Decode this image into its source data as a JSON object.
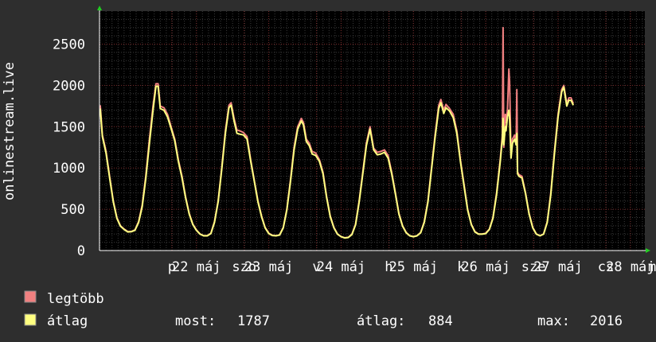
{
  "chart_data": {
    "type": "line",
    "ylabel": "onlinestream.live",
    "ylim": [
      0,
      2900
    ],
    "yticks": [
      0,
      500,
      1000,
      1500,
      2000,
      2500
    ],
    "grid": true,
    "x_tick_labels": [
      "p",
      "22 máj",
      "szo",
      "23 máj",
      "v",
      "24 máj",
      "h",
      "25 máj",
      "k",
      "26 máj",
      "sze",
      "27 máj",
      "cs",
      "28 máj"
    ],
    "x_tick_days": [
      1.66,
      2.0,
      2.66,
      3.0,
      3.66,
      4.0,
      4.66,
      5.0,
      5.66,
      6.0,
      6.66,
      7.0,
      7.66,
      8.0
    ],
    "x_truncated_label": "m",
    "x_range_days": [
      0.66,
      8.2
    ],
    "series": [
      {
        "name": "legtöbb",
        "color": "#f08080",
        "points": [
          [
            0.67,
            1760
          ],
          [
            0.7,
            1400
          ],
          [
            0.75,
            1200
          ],
          [
            0.8,
            900
          ],
          [
            0.85,
            600
          ],
          [
            0.9,
            400
          ],
          [
            0.95,
            300
          ],
          [
            1.0,
            260
          ],
          [
            1.05,
            230
          ],
          [
            1.1,
            230
          ],
          [
            1.15,
            250
          ],
          [
            1.2,
            350
          ],
          [
            1.25,
            550
          ],
          [
            1.3,
            900
          ],
          [
            1.35,
            1350
          ],
          [
            1.4,
            1750
          ],
          [
            1.44,
            2020
          ],
          [
            1.47,
            2020
          ],
          [
            1.5,
            1750
          ],
          [
            1.55,
            1730
          ],
          [
            1.6,
            1650
          ],
          [
            1.65,
            1500
          ],
          [
            1.7,
            1350
          ],
          [
            1.75,
            1100
          ],
          [
            1.8,
            900
          ],
          [
            1.85,
            650
          ],
          [
            1.9,
            450
          ],
          [
            1.95,
            320
          ],
          [
            2.0,
            250
          ],
          [
            2.05,
            200
          ],
          [
            2.1,
            180
          ],
          [
            2.15,
            180
          ],
          [
            2.2,
            210
          ],
          [
            2.25,
            350
          ],
          [
            2.3,
            600
          ],
          [
            2.35,
            1000
          ],
          [
            2.4,
            1450
          ],
          [
            2.45,
            1760
          ],
          [
            2.48,
            1790
          ],
          [
            2.52,
            1600
          ],
          [
            2.56,
            1460
          ],
          [
            2.6,
            1450
          ],
          [
            2.65,
            1430
          ],
          [
            2.7,
            1380
          ],
          [
            2.75,
            1100
          ],
          [
            2.8,
            850
          ],
          [
            2.85,
            600
          ],
          [
            2.9,
            420
          ],
          [
            2.95,
            280
          ],
          [
            3.0,
            210
          ],
          [
            3.05,
            185
          ],
          [
            3.1,
            180
          ],
          [
            3.15,
            190
          ],
          [
            3.2,
            280
          ],
          [
            3.25,
            500
          ],
          [
            3.3,
            850
          ],
          [
            3.35,
            1250
          ],
          [
            3.4,
            1500
          ],
          [
            3.45,
            1600
          ],
          [
            3.48,
            1550
          ],
          [
            3.52,
            1350
          ],
          [
            3.56,
            1300
          ],
          [
            3.6,
            1200
          ],
          [
            3.65,
            1180
          ],
          [
            3.7,
            1100
          ],
          [
            3.75,
            950
          ],
          [
            3.8,
            650
          ],
          [
            3.85,
            420
          ],
          [
            3.9,
            280
          ],
          [
            3.95,
            200
          ],
          [
            4.0,
            170
          ],
          [
            4.05,
            155
          ],
          [
            4.1,
            160
          ],
          [
            4.15,
            200
          ],
          [
            4.2,
            320
          ],
          [
            4.25,
            600
          ],
          [
            4.3,
            950
          ],
          [
            4.35,
            1300
          ],
          [
            4.4,
            1500
          ],
          [
            4.45,
            1240
          ],
          [
            4.5,
            1190
          ],
          [
            4.55,
            1200
          ],
          [
            4.6,
            1220
          ],
          [
            4.65,
            1150
          ],
          [
            4.7,
            950
          ],
          [
            4.75,
            700
          ],
          [
            4.8,
            450
          ],
          [
            4.85,
            300
          ],
          [
            4.9,
            220
          ],
          [
            4.95,
            180
          ],
          [
            5.0,
            170
          ],
          [
            5.05,
            180
          ],
          [
            5.1,
            220
          ],
          [
            5.15,
            350
          ],
          [
            5.2,
            600
          ],
          [
            5.25,
            1000
          ],
          [
            5.3,
            1400
          ],
          [
            5.35,
            1760
          ],
          [
            5.38,
            1830
          ],
          [
            5.42,
            1700
          ],
          [
            5.45,
            1770
          ],
          [
            5.5,
            1720
          ],
          [
            5.55,
            1650
          ],
          [
            5.6,
            1450
          ],
          [
            5.65,
            1100
          ],
          [
            5.7,
            800
          ],
          [
            5.75,
            500
          ],
          [
            5.8,
            320
          ],
          [
            5.85,
            230
          ],
          [
            5.9,
            200
          ],
          [
            5.95,
            200
          ],
          [
            6.0,
            210
          ],
          [
            6.05,
            260
          ],
          [
            6.1,
            400
          ],
          [
            6.15,
            700
          ],
          [
            6.2,
            1100
          ],
          [
            6.23,
            1400
          ],
          [
            6.24,
            2700
          ],
          [
            6.25,
            1250
          ],
          [
            6.27,
            1650
          ],
          [
            6.28,
            1550
          ],
          [
            6.3,
            1700
          ],
          [
            6.32,
            2200
          ],
          [
            6.33,
            2050
          ],
          [
            6.35,
            1150
          ],
          [
            6.37,
            1350
          ],
          [
            6.4,
            1400
          ],
          [
            6.42,
            1300
          ],
          [
            6.43,
            1950
          ],
          [
            6.44,
            950
          ],
          [
            6.46,
            920
          ],
          [
            6.5,
            900
          ],
          [
            6.55,
            700
          ],
          [
            6.6,
            450
          ],
          [
            6.65,
            280
          ],
          [
            6.7,
            200
          ],
          [
            6.75,
            180
          ],
          [
            6.8,
            200
          ],
          [
            6.85,
            350
          ],
          [
            6.9,
            700
          ],
          [
            6.95,
            1200
          ],
          [
            7.0,
            1650
          ],
          [
            7.05,
            1950
          ],
          [
            7.08,
            2000
          ],
          [
            7.12,
            1780
          ],
          [
            7.15,
            1850
          ],
          [
            7.18,
            1850
          ],
          [
            7.21,
            1780
          ]
        ]
      },
      {
        "name": "átlag",
        "color": "#ffff80",
        "points": [
          [
            0.67,
            1720
          ],
          [
            0.7,
            1380
          ],
          [
            0.75,
            1180
          ],
          [
            0.8,
            880
          ],
          [
            0.85,
            590
          ],
          [
            0.9,
            390
          ],
          [
            0.95,
            295
          ],
          [
            1.0,
            255
          ],
          [
            1.05,
            225
          ],
          [
            1.1,
            228
          ],
          [
            1.15,
            245
          ],
          [
            1.2,
            340
          ],
          [
            1.25,
            530
          ],
          [
            1.3,
            870
          ],
          [
            1.35,
            1300
          ],
          [
            1.4,
            1700
          ],
          [
            1.44,
            1990
          ],
          [
            1.47,
            1990
          ],
          [
            1.5,
            1720
          ],
          [
            1.55,
            1700
          ],
          [
            1.6,
            1620
          ],
          [
            1.65,
            1480
          ],
          [
            1.7,
            1330
          ],
          [
            1.75,
            1080
          ],
          [
            1.8,
            880
          ],
          [
            1.85,
            640
          ],
          [
            1.9,
            440
          ],
          [
            1.95,
            315
          ],
          [
            2.0,
            245
          ],
          [
            2.05,
            198
          ],
          [
            2.1,
            178
          ],
          [
            2.15,
            178
          ],
          [
            2.2,
            205
          ],
          [
            2.25,
            340
          ],
          [
            2.3,
            590
          ],
          [
            2.35,
            980
          ],
          [
            2.4,
            1420
          ],
          [
            2.45,
            1730
          ],
          [
            2.48,
            1760
          ],
          [
            2.52,
            1570
          ],
          [
            2.56,
            1420
          ],
          [
            2.6,
            1410
          ],
          [
            2.65,
            1400
          ],
          [
            2.7,
            1350
          ],
          [
            2.75,
            1080
          ],
          [
            2.8,
            840
          ],
          [
            2.85,
            590
          ],
          [
            2.9,
            410
          ],
          [
            2.95,
            275
          ],
          [
            3.0,
            205
          ],
          [
            3.05,
            182
          ],
          [
            3.1,
            178
          ],
          [
            3.15,
            188
          ],
          [
            3.2,
            275
          ],
          [
            3.25,
            490
          ],
          [
            3.3,
            830
          ],
          [
            3.35,
            1220
          ],
          [
            3.4,
            1470
          ],
          [
            3.45,
            1570
          ],
          [
            3.48,
            1520
          ],
          [
            3.52,
            1320
          ],
          [
            3.56,
            1270
          ],
          [
            3.6,
            1170
          ],
          [
            3.65,
            1150
          ],
          [
            3.7,
            1080
          ],
          [
            3.75,
            930
          ],
          [
            3.8,
            640
          ],
          [
            3.85,
            410
          ],
          [
            3.9,
            275
          ],
          [
            3.95,
            198
          ],
          [
            4.0,
            168
          ],
          [
            4.05,
            152
          ],
          [
            4.1,
            158
          ],
          [
            4.15,
            195
          ],
          [
            4.2,
            310
          ],
          [
            4.25,
            585
          ],
          [
            4.3,
            930
          ],
          [
            4.35,
            1270
          ],
          [
            4.4,
            1470
          ],
          [
            4.45,
            1220
          ],
          [
            4.5,
            1160
          ],
          [
            4.55,
            1170
          ],
          [
            4.6,
            1190
          ],
          [
            4.65,
            1120
          ],
          [
            4.7,
            930
          ],
          [
            4.75,
            690
          ],
          [
            4.8,
            440
          ],
          [
            4.85,
            295
          ],
          [
            4.9,
            215
          ],
          [
            4.95,
            178
          ],
          [
            5.0,
            168
          ],
          [
            5.05,
            178
          ],
          [
            5.1,
            215
          ],
          [
            5.15,
            340
          ],
          [
            5.2,
            585
          ],
          [
            5.25,
            980
          ],
          [
            5.3,
            1370
          ],
          [
            5.35,
            1720
          ],
          [
            5.38,
            1790
          ],
          [
            5.42,
            1660
          ],
          [
            5.45,
            1730
          ],
          [
            5.5,
            1690
          ],
          [
            5.55,
            1610
          ],
          [
            5.6,
            1420
          ],
          [
            5.65,
            1080
          ],
          [
            5.7,
            780
          ],
          [
            5.75,
            490
          ],
          [
            5.8,
            315
          ],
          [
            5.85,
            225
          ],
          [
            5.9,
            198
          ],
          [
            5.95,
            198
          ],
          [
            6.0,
            205
          ],
          [
            6.05,
            255
          ],
          [
            6.1,
            390
          ],
          [
            6.15,
            680
          ],
          [
            6.2,
            1070
          ],
          [
            6.23,
            1350
          ],
          [
            6.24,
            1600
          ],
          [
            6.25,
            1280
          ],
          [
            6.27,
            1500
          ],
          [
            6.28,
            1450
          ],
          [
            6.3,
            1620
          ],
          [
            6.32,
            1700
          ],
          [
            6.33,
            1600
          ],
          [
            6.35,
            1120
          ],
          [
            6.37,
            1300
          ],
          [
            6.4,
            1350
          ],
          [
            6.42,
            1280
          ],
          [
            6.43,
            1420
          ],
          [
            6.44,
            930
          ],
          [
            6.46,
            900
          ],
          [
            6.5,
            880
          ],
          [
            6.55,
            690
          ],
          [
            6.6,
            440
          ],
          [
            6.65,
            275
          ],
          [
            6.7,
            198
          ],
          [
            6.75,
            178
          ],
          [
            6.8,
            198
          ],
          [
            6.85,
            340
          ],
          [
            6.9,
            680
          ],
          [
            6.95,
            1170
          ],
          [
            7.0,
            1620
          ],
          [
            7.05,
            1920
          ],
          [
            7.08,
            1980
          ],
          [
            7.12,
            1750
          ],
          [
            7.15,
            1820
          ],
          [
            7.18,
            1820
          ],
          [
            7.21,
            1760
          ]
        ]
      }
    ],
    "legend": [
      {
        "label": "legtöbb",
        "color": "#f08080"
      },
      {
        "label": "átlag",
        "color": "#ffff80"
      }
    ],
    "stats": {
      "most_label": "most:",
      "most_value": "1787",
      "atlag_label": "átlag:",
      "atlag_value": "884",
      "max_label": "max:",
      "max_value": "2016"
    }
  }
}
